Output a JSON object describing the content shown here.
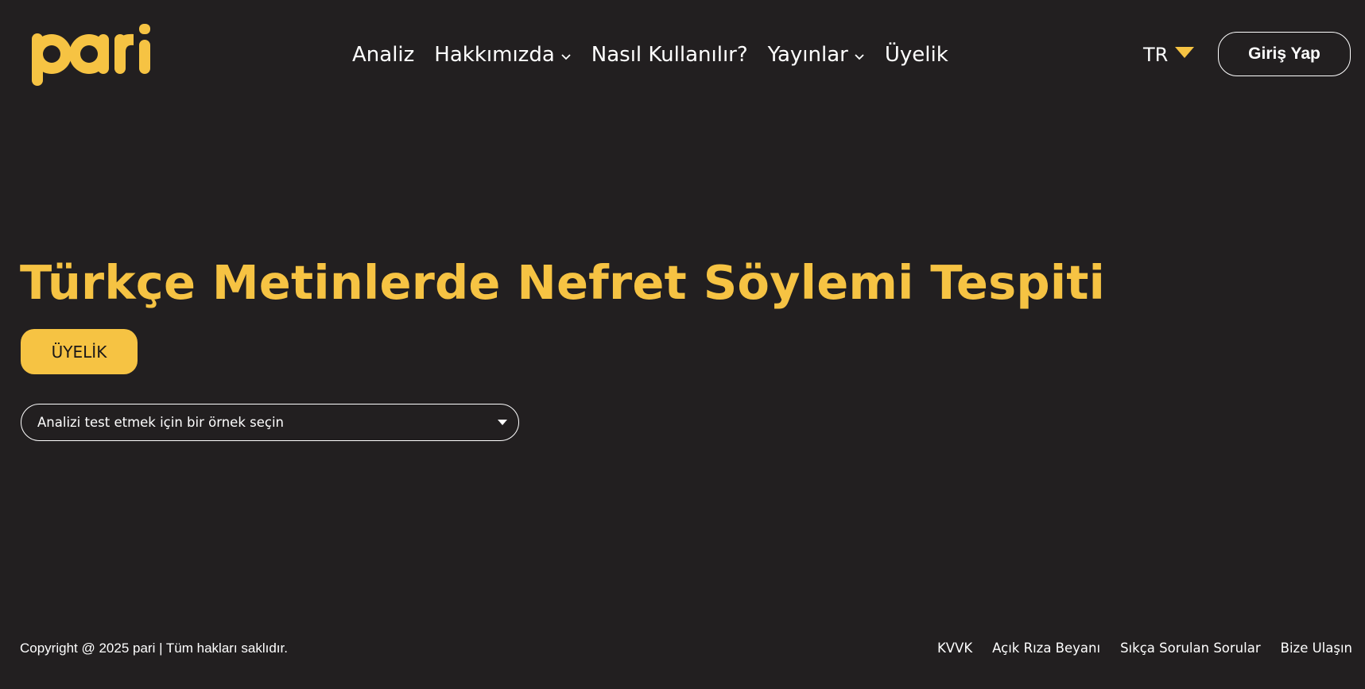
{
  "brand": {
    "logo_text": "pari",
    "logo_color": "#f6c343"
  },
  "nav": {
    "items": [
      {
        "label": "Analiz",
        "has_dropdown": false
      },
      {
        "label": "Hakkımızda",
        "has_dropdown": true,
        "icon": "chevron-down-icon"
      },
      {
        "label": "Nasıl Kullanılır?",
        "has_dropdown": false
      },
      {
        "label": "Yayınlar",
        "has_dropdown": true,
        "icon": "chevron-down-icon"
      },
      {
        "label": "Üyelik",
        "has_dropdown": false
      }
    ]
  },
  "language": {
    "selected": "TR",
    "icon": "caret-down-icon"
  },
  "header": {
    "login_label": "Giriş Yap"
  },
  "hero": {
    "title": "Türkçe Metinlerde Nefret Söylemi Tespiti",
    "member_button_label": "ÜYELİK",
    "sample_select": {
      "selected_label": "Analizi test etmek için bir örnek seçin",
      "icon": "caret-down-icon"
    }
  },
  "footer": {
    "copyright": "Copyright @ 2025 pari | Tüm hakları saklıdır.",
    "links": [
      "KVVK",
      "Açık Rıza Beyanı",
      "Sıkça Sorulan Sorular",
      "Bize Ulaşın"
    ]
  },
  "colors": {
    "background": "#221f20",
    "accent": "#f6c343",
    "text": "#ffffff"
  }
}
